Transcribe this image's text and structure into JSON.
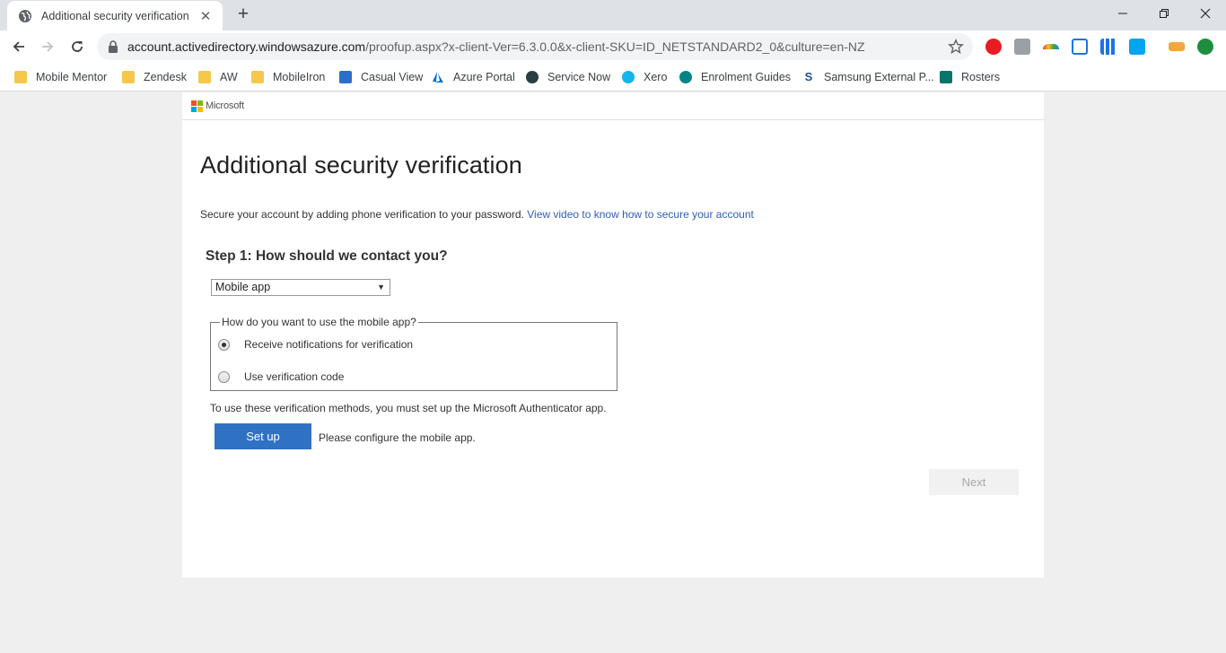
{
  "browser": {
    "tab": {
      "title": "Additional security verification",
      "icon": "globe-icon"
    },
    "address": {
      "host": "account.activedirectory.windowsazure.com",
      "path": "/proofup.aspx?x-client-Ver=6.3.0.0&x-client-SKU=ID_NETSTANDARD2_0&culture=en-NZ"
    },
    "bookmarks": [
      {
        "label": "Mobile Mentor",
        "icon": "folder-icon"
      },
      {
        "label": "Zendesk",
        "icon": "folder-icon"
      },
      {
        "label": "AW",
        "icon": "folder-icon"
      },
      {
        "label": "MobileIron",
        "icon": "folder-icon"
      },
      {
        "label": "Casual View",
        "icon": "casual-view-icon"
      },
      {
        "label": "Azure Portal",
        "icon": "azure-icon"
      },
      {
        "label": "Service Now",
        "icon": "servicenow-icon"
      },
      {
        "label": "Xero",
        "icon": "xero-icon"
      },
      {
        "label": "Enrolment Guides",
        "icon": "sharepoint-icon"
      },
      {
        "label": "Samsung External P...",
        "icon": "samsung-s-icon"
      },
      {
        "label": "Rosters",
        "icon": "forms-icon"
      }
    ]
  },
  "page": {
    "brand": "Microsoft",
    "title": "Additional security verification",
    "intro_text": "Secure your account by adding phone verification to your password.",
    "intro_link": "View video to know how to secure your account",
    "step1_title": "Step 1: How should we contact you?",
    "contact_method": {
      "selected": "Mobile app"
    },
    "mobile_app_usage": {
      "legend": "How do you want to use the mobile app?",
      "options": [
        {
          "label": "Receive notifications for verification",
          "checked": true
        },
        {
          "label": "Use verification code",
          "checked": false
        }
      ]
    },
    "authenticator_note": "To use these verification methods, you must set up the Microsoft Authenticator app.",
    "setup_button": "Set up",
    "setup_status": "Please configure the mobile app.",
    "next_button": "Next"
  },
  "colors": {
    "link": "#2f5fb7",
    "primary_button": "#2f72c4",
    "disabled_button_bg": "#f1f1f1",
    "ms_red": "#f25022",
    "ms_green": "#7fba00",
    "ms_blue": "#00a4ef",
    "ms_yellow": "#ffb900"
  }
}
